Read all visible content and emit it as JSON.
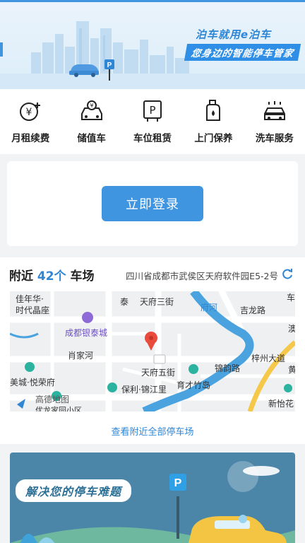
{
  "banner": {
    "slogan_main": "泊车就用e泊车",
    "slogan_sub": "您身边的智能停车管家"
  },
  "services": [
    {
      "label": "月租续费",
      "icon": "yen-coin-icon"
    },
    {
      "label": "储值车",
      "icon": "stored-value-car-icon"
    },
    {
      "label": "车位租赁",
      "icon": "parking-space-icon"
    },
    {
      "label": "上门保养",
      "icon": "oil-bottle-icon"
    },
    {
      "label": "洗车服务",
      "icon": "car-wash-icon"
    }
  ],
  "login": {
    "button_label": "立即登录"
  },
  "nearby": {
    "prefix": "附近",
    "count": "42个",
    "suffix": "车场",
    "address": "四川省成都市武侯区天府软件园E5-2号",
    "view_all": "查看附近全部停车场"
  },
  "map": {
    "labels": {
      "l1": "佳年华·",
      "l2": "时代晶座",
      "l3": "成都银泰城",
      "l4": "肖家河",
      "l5": "天府三街",
      "l6": "府河",
      "l7": "吉龙路",
      "l8": "天府五街",
      "l9": "锦韵路",
      "l10": "梓州大道",
      "l11": "美城·悦荣府",
      "l12": "保利·锦江里",
      "l13": "育才竹岛",
      "l14": "新怡花",
      "l15": "高德地图",
      "l16": "泰",
      "l17": "车",
      "l18": "澳",
      "l19": "黄",
      "l20": "优龙家园小区"
    }
  },
  "promo": {
    "title": "解决您的停车难题"
  },
  "colors": {
    "accent": "#3f95e0",
    "link": "#2e86d4",
    "river": "#4aa3df"
  }
}
